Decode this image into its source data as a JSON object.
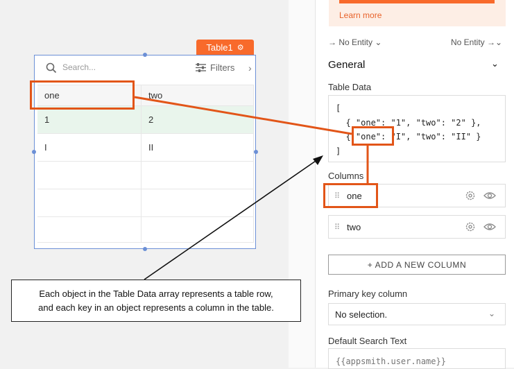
{
  "widget": {
    "name": "Table1",
    "gear_icon": "gear-icon"
  },
  "table": {
    "search_placeholder": "Search...",
    "filters_label": "Filters",
    "columns": [
      "one",
      "two"
    ],
    "rows": [
      [
        "1",
        "2"
      ],
      [
        "I",
        "II"
      ],
      [
        "",
        ""
      ],
      [
        "",
        ""
      ],
      [
        "",
        ""
      ]
    ]
  },
  "callout": {
    "line1": "Each object in the Table Data array represents a table row,",
    "line2": "and each key in an object represents a column in the table."
  },
  "panel": {
    "learn_more": "Learn more",
    "entity_left": "→ No Entity ⌄",
    "entity_right": "No Entity →⌄",
    "section_title": "General",
    "table_data_label": "Table Data",
    "table_data_code": "[\n  { \"one\": \"1\", \"two\": \"2\" },\n  { \"one\": \"I\", \"two\": \"II\" }\n]",
    "columns_label": "Columns",
    "column_items": [
      "one",
      "two"
    ],
    "add_column_label": "+ ADD A NEW COLUMN",
    "primary_key_label": "Primary key column",
    "primary_key_value": "No selection.",
    "default_search_label": "Default Search Text",
    "default_search_placeholder": "{{appsmith.user.name}}"
  },
  "colors": {
    "accent": "#f86a2b",
    "highlight": "#e25518",
    "selection": "#6b8fd6",
    "selected_row": "#e9f5ec"
  }
}
